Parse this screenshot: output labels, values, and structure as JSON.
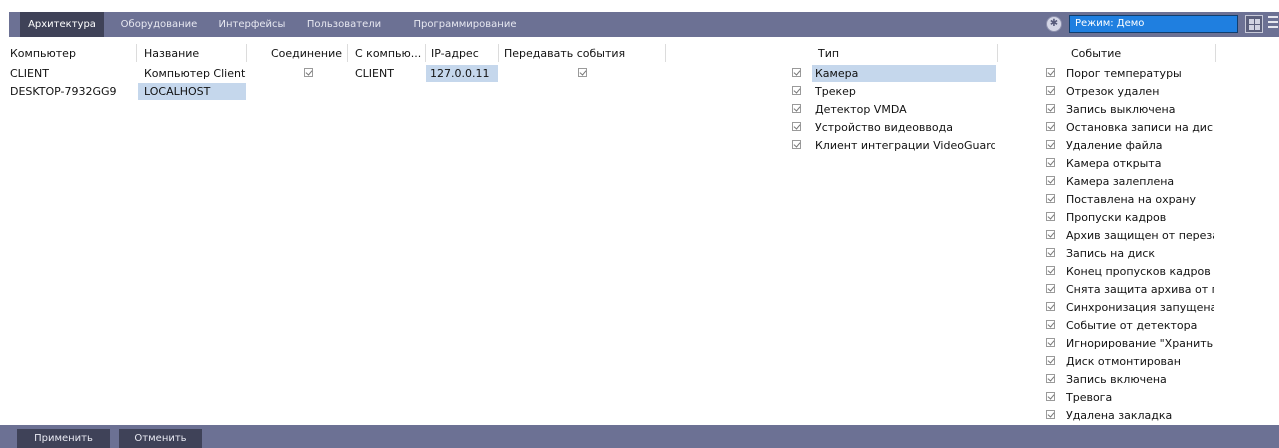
{
  "tabs": [
    {
      "label": "Архитектура"
    },
    {
      "label": "Оборудование"
    },
    {
      "label": "Интерфейсы"
    },
    {
      "label": "Пользователи"
    },
    {
      "label": "Программирование"
    }
  ],
  "mode": {
    "value": "Режим: Демо",
    "icon": "settings-circle-icon"
  },
  "computers": {
    "headers": [
      "Компьютер",
      "Название"
    ],
    "rows": [
      {
        "computer": "CLIENT",
        "name": "Компьютер Client"
      },
      {
        "computer": "DESKTOP-7932GG9",
        "name": "LOCALHOST"
      }
    ]
  },
  "connections": {
    "headers": [
      "Соединение",
      "С компью...",
      "IP-адрес",
      "Передавать события"
    ],
    "rows": [
      {
        "connection": true,
        "from": "CLIENT",
        "ip": "127.0.0.11",
        "send": true
      }
    ]
  },
  "types": {
    "header": "Тип",
    "items": [
      "Камера",
      "Трекер",
      "Детектор VMDA",
      "Устройство видеоввода",
      "Клиент интеграции VideoGuard"
    ]
  },
  "events": {
    "header": "Событие",
    "items": [
      "Порог температуры",
      "Отрезок удален",
      "Запись выключена",
      "Остановка записи на диск",
      "Удаление файла",
      "Камера открыта",
      "Камера залеплена",
      "Поставлена на охрану",
      "Пропуски кадров",
      "Архив защищен от переза..",
      "Запись на диск",
      "Конец пропусков кадров",
      "Снята защита архива от пе..",
      "Синхронизация запущена",
      "Событие от детектора",
      "Игнорирование \"Хранить ..",
      "Диск отмонтирован",
      "Запись включена",
      "Тревога",
      "Удалена закладка"
    ]
  },
  "footer": {
    "apply_label": "Применить",
    "cancel_label": "Отменить"
  },
  "colors": {
    "toolbar": "#6c7194",
    "active_tab": "#3f4258",
    "mode_field": "#1f7fe0",
    "selection": "#c5d7ec"
  }
}
